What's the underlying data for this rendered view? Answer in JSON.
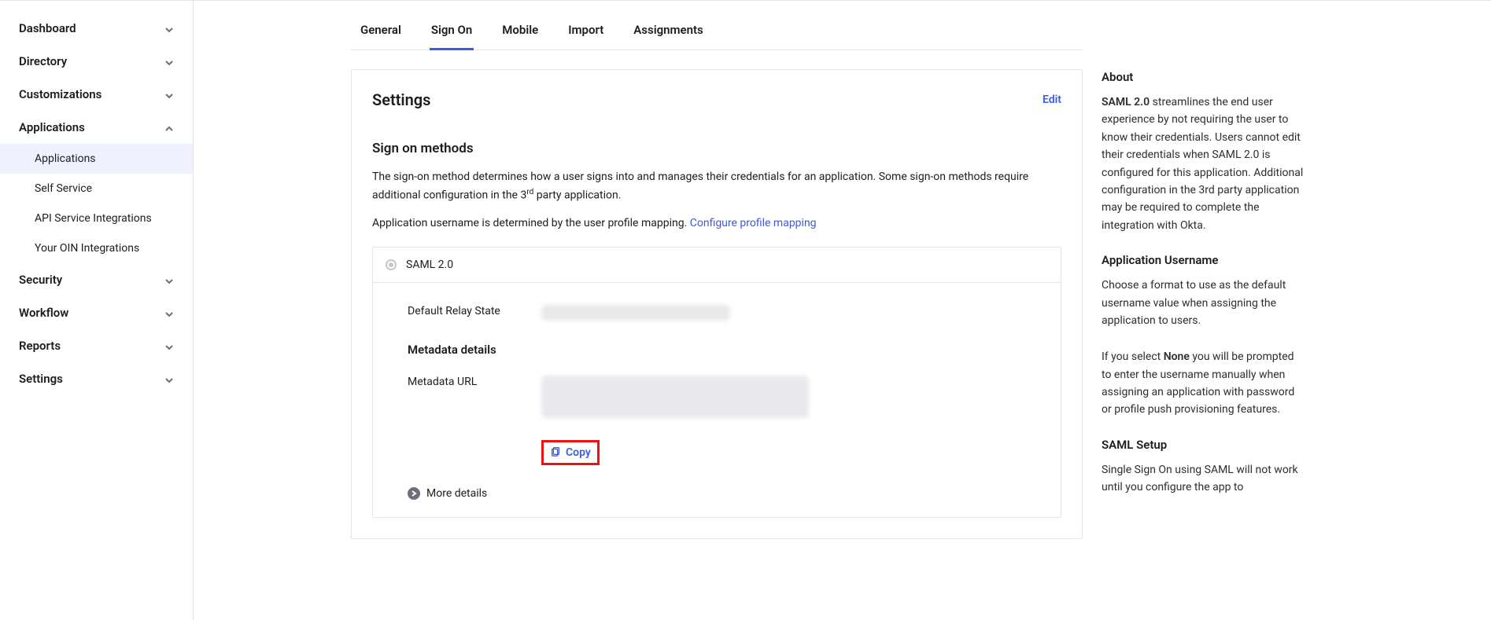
{
  "sidebar": {
    "items": [
      {
        "label": "Dashboard",
        "expanded": false
      },
      {
        "label": "Directory",
        "expanded": false
      },
      {
        "label": "Customizations",
        "expanded": false
      },
      {
        "label": "Applications",
        "expanded": true,
        "children": [
          {
            "label": "Applications",
            "active": true
          },
          {
            "label": "Self Service"
          },
          {
            "label": "API Service Integrations"
          },
          {
            "label": "Your OIN Integrations"
          }
        ]
      },
      {
        "label": "Security",
        "expanded": false
      },
      {
        "label": "Workflow",
        "expanded": false
      },
      {
        "label": "Reports",
        "expanded": false
      },
      {
        "label": "Settings",
        "expanded": false
      }
    ]
  },
  "tabs": [
    {
      "label": "General"
    },
    {
      "label": "Sign On",
      "active": true
    },
    {
      "label": "Mobile"
    },
    {
      "label": "Import"
    },
    {
      "label": "Assignments"
    }
  ],
  "settings": {
    "title": "Settings",
    "edit": "Edit",
    "sign_on_methods": "Sign on methods",
    "desc1_a": "The sign-on method determines how a user signs into and manages their credentials for an application. Some sign-on methods require additional configuration in the 3",
    "desc1_sup": "rd",
    "desc1_b": " party application.",
    "desc2": "Application username is determined by the user profile mapping. ",
    "configure_link": "Configure profile mapping",
    "saml_label": "SAML 2.0",
    "relay_label": "Default Relay State",
    "metadata_details": "Metadata details",
    "metadata_url_label": "Metadata URL",
    "copy": "Copy",
    "more_details": "More details"
  },
  "info": {
    "about_h": "About",
    "about_bold": "SAML 2.0",
    "about_p": " streamlines the end user experience by not requiring the user to know their credentials. Users cannot edit their credentials when SAML 2.0 is configured for this application. Additional configuration in the 3rd party application may be required to complete the integration with Okta.",
    "app_user_h": "Application Username",
    "app_user_p1": "Choose a format to use as the default username value when assigning the application to users.",
    "app_user_p2a": "If you select ",
    "app_user_p2_bold": "None",
    "app_user_p2b": " you will be prompted to enter the username manually when assigning an application with password or profile push provisioning features.",
    "saml_setup_h": "SAML Setup",
    "saml_setup_p": "Single Sign On using SAML will not work until you configure the app to"
  }
}
